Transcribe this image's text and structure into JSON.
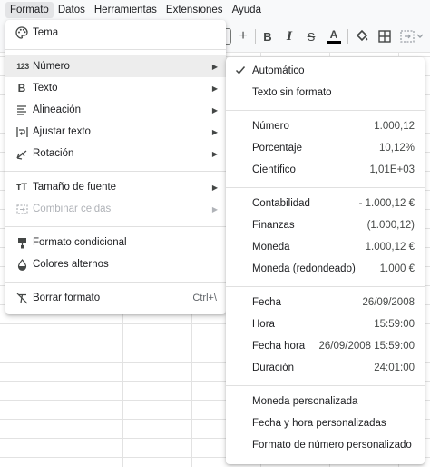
{
  "menubar": {
    "items": [
      {
        "label": "Formato",
        "active": true
      },
      {
        "label": "Datos"
      },
      {
        "label": "Herramientas"
      },
      {
        "label": "Extensiones"
      },
      {
        "label": "Ayuda"
      }
    ]
  },
  "toolbar": {
    "plus_label": "+",
    "bold_label": "B",
    "italic_label": "I",
    "strike_label": "S",
    "textcolor_label": "A",
    "text_color": "#000000"
  },
  "format_menu": {
    "items": [
      {
        "id": "tema",
        "label": "Tema",
        "icon": "palette-icon"
      },
      {
        "id": "numero",
        "label": "Número",
        "icon": "number-123-icon",
        "submenu": true,
        "highlighted": true
      },
      {
        "id": "texto",
        "label": "Texto",
        "icon": "bold-icon",
        "submenu": true
      },
      {
        "id": "alineacion",
        "label": "Alineación",
        "icon": "align-icon",
        "submenu": true
      },
      {
        "id": "ajustar",
        "label": "Ajustar texto",
        "icon": "wrap-text-icon",
        "submenu": true
      },
      {
        "id": "rotacion",
        "label": "Rotación",
        "icon": "text-rotation-icon",
        "submenu": true
      },
      {
        "id": "tamano",
        "label": "Tamaño de fuente",
        "icon": "font-size-icon",
        "submenu": true
      },
      {
        "id": "combinar",
        "label": "Combinar celdas",
        "icon": "merge-cells-icon",
        "submenu": true,
        "disabled": true
      },
      {
        "id": "condicional",
        "label": "Formato condicional",
        "icon": "conditional-format-icon"
      },
      {
        "id": "alternos",
        "label": "Colores alternos",
        "icon": "alternating-colors-icon"
      },
      {
        "id": "borrar",
        "label": "Borrar formato",
        "icon": "clear-format-icon",
        "shortcut": "Ctrl+\\"
      }
    ]
  },
  "number_submenu": {
    "items": [
      {
        "label": "Automático",
        "checked": true
      },
      {
        "label": "Texto sin formato"
      },
      {
        "label": "Número",
        "value": "1.000,12"
      },
      {
        "label": "Porcentaje",
        "value": "10,12%"
      },
      {
        "label": "Científico",
        "value": "1,01E+03"
      },
      {
        "label": "Contabilidad",
        "value": "- 1.000,12 €"
      },
      {
        "label": "Finanzas",
        "value": "(1.000,12)"
      },
      {
        "label": "Moneda",
        "value": "1.000,12 €"
      },
      {
        "label": "Moneda (redondeado)",
        "value": "1.000 €"
      },
      {
        "label": "Fecha",
        "value": "26/09/2008"
      },
      {
        "label": "Hora",
        "value": "15:59:00"
      },
      {
        "label": "Fecha hora",
        "value": "26/09/2008 15:59:00"
      },
      {
        "label": "Duración",
        "value": "24:01:00"
      },
      {
        "label": "Moneda personalizada"
      },
      {
        "label": "Fecha y hora personalizadas"
      },
      {
        "label": "Formato de número personalizado"
      }
    ]
  }
}
